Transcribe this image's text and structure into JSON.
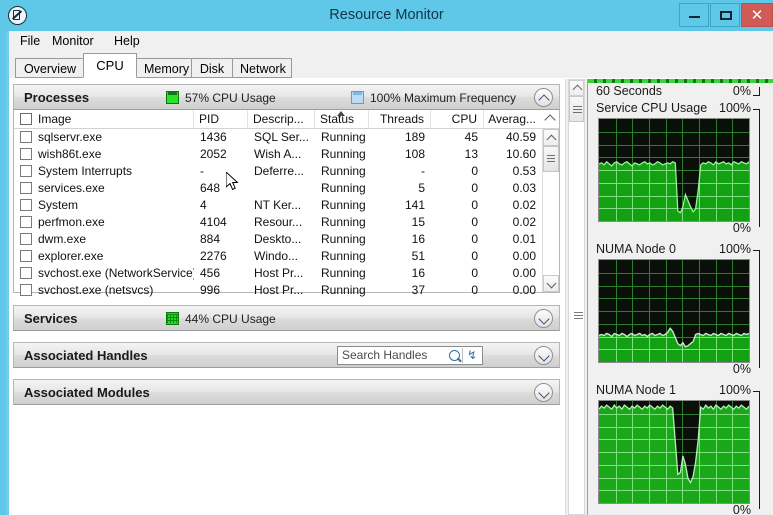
{
  "window": {
    "title": "Resource Monitor",
    "icon": "resource-monitor-icon",
    "minimize_label": "–",
    "maximize_label": "□",
    "close_label": "✕"
  },
  "menu": {
    "items": [
      {
        "label": "File"
      },
      {
        "label": "Monitor"
      },
      {
        "label": "Help"
      }
    ]
  },
  "tabs": {
    "active": "CPU",
    "items": [
      {
        "label": "Overview"
      },
      {
        "label": "CPU"
      },
      {
        "label": "Memory"
      },
      {
        "label": "Disk"
      },
      {
        "label": "Network"
      }
    ]
  },
  "sections": {
    "processes": {
      "title": "Processes",
      "cpu_usage": "57% CPU Usage",
      "max_frequency": "100% Maximum Frequency",
      "expanded": true,
      "columns": [
        {
          "key": "image",
          "label": "Image"
        },
        {
          "key": "pid",
          "label": "PID"
        },
        {
          "key": "desc",
          "label": "Descrip..."
        },
        {
          "key": "status",
          "label": "Status"
        },
        {
          "key": "threads",
          "label": "Threads"
        },
        {
          "key": "cpu",
          "label": "CPU"
        },
        {
          "key": "average",
          "label": "Averag..."
        }
      ],
      "sort_column": "Status",
      "rows": [
        {
          "image": "sqlservr.exe",
          "pid": "1436",
          "desc": "SQL Ser...",
          "status": "Running",
          "threads": "189",
          "cpu": "45",
          "average": "40.59"
        },
        {
          "image": "wish86t.exe",
          "pid": "2052",
          "desc": "Wish A...",
          "status": "Running",
          "threads": "108",
          "cpu": "13",
          "average": "10.60"
        },
        {
          "image": "System Interrupts",
          "pid": "-",
          "desc": "Deferre...",
          "status": "Running",
          "threads": "-",
          "cpu": "0",
          "average": "0.53"
        },
        {
          "image": "services.exe",
          "pid": "648",
          "desc": "",
          "status": "Running",
          "threads": "5",
          "cpu": "0",
          "average": "0.03"
        },
        {
          "image": "System",
          "pid": "4",
          "desc": "NT Ker...",
          "status": "Running",
          "threads": "141",
          "cpu": "0",
          "average": "0.02"
        },
        {
          "image": "perfmon.exe",
          "pid": "4104",
          "desc": "Resour...",
          "status": "Running",
          "threads": "15",
          "cpu": "0",
          "average": "0.02"
        },
        {
          "image": "dwm.exe",
          "pid": "884",
          "desc": "Deskto...",
          "status": "Running",
          "threads": "16",
          "cpu": "0",
          "average": "0.01"
        },
        {
          "image": "explorer.exe",
          "pid": "2276",
          "desc": "Windo...",
          "status": "Running",
          "threads": "51",
          "cpu": "0",
          "average": "0.00"
        },
        {
          "image": "svchost.exe (NetworkService)",
          "pid": "456",
          "desc": "Host Pr...",
          "status": "Running",
          "threads": "16",
          "cpu": "0",
          "average": "0.00"
        },
        {
          "image": "svchost.exe (netsvcs)",
          "pid": "996",
          "desc": "Host Pr...",
          "status": "Running",
          "threads": "37",
          "cpu": "0",
          "average": "0.00"
        }
      ]
    },
    "services": {
      "title": "Services",
      "cpu_usage": "44% CPU Usage",
      "expanded": false
    },
    "associated_handles": {
      "title": "Associated Handles",
      "search_placeholder": "Search Handles",
      "search_value": "",
      "expanded": false
    },
    "associated_modules": {
      "title": "Associated Modules",
      "expanded": false
    }
  },
  "graphs": [
    {
      "name": "cpu-total-graph",
      "label": "60 Seconds",
      "value": "0%",
      "top_label": "",
      "is_strip": true
    },
    {
      "name": "service-cpu-usage-graph",
      "label": "Service CPU Usage",
      "top_value": "100%",
      "bottom_value": "0%"
    },
    {
      "name": "numa-node-0-graph",
      "label": "NUMA Node 0",
      "top_value": "100%",
      "bottom_value": "0%"
    },
    {
      "name": "numa-node-1-graph",
      "label": "NUMA Node 1",
      "top_value": "100%",
      "bottom_value": "0%"
    }
  ],
  "chart_data": [
    {
      "type": "area",
      "title": "Service CPU Usage",
      "ylabel": "%",
      "xlabel": "60 Seconds",
      "ylim": [
        0,
        100
      ],
      "grid": true,
      "line_color": "#9cf09c",
      "fill_color": "#13a013",
      "bg_color": "#0a0f0a",
      "values": [
        56,
        57,
        55,
        58,
        56,
        54,
        57,
        58,
        56,
        55,
        57,
        58,
        56,
        54,
        57,
        56,
        55,
        57,
        58,
        56,
        57,
        55,
        56,
        58,
        57,
        55,
        56,
        57,
        56,
        58,
        57,
        10,
        8,
        14,
        26,
        20,
        14,
        9,
        12,
        30,
        55,
        57,
        56,
        58,
        57,
        55,
        58,
        56,
        57,
        58,
        56,
        57,
        55,
        58,
        57,
        56,
        58,
        57,
        56,
        58
      ]
    },
    {
      "type": "area",
      "title": "NUMA Node 0",
      "ylabel": "%",
      "ylim": [
        0,
        100
      ],
      "grid": true,
      "line_color": "#cfeccf",
      "fill_color": "#13a013",
      "bg_color": "#0a0f0a",
      "values": [
        26,
        27,
        26,
        28,
        27,
        25,
        28,
        27,
        26,
        28,
        27,
        25,
        27,
        28,
        26,
        27,
        28,
        26,
        27,
        25,
        27,
        28,
        26,
        27,
        28,
        26,
        27,
        29,
        33,
        30,
        24,
        18,
        16,
        19,
        15,
        16,
        18,
        20,
        27,
        28,
        27,
        26,
        28,
        27,
        26,
        28,
        27,
        26,
        28,
        27,
        26,
        28,
        27,
        26,
        28,
        27,
        26,
        28,
        27,
        28
      ]
    },
    {
      "type": "area",
      "title": "NUMA Node 1",
      "ylabel": "%",
      "ylim": [
        0,
        100
      ],
      "grid": true,
      "line_color": "#b6f0b6",
      "fill_color": "#1aa81a",
      "bg_color": "#0a0f0a",
      "values": [
        92,
        95,
        93,
        96,
        94,
        92,
        96,
        93,
        95,
        92,
        96,
        94,
        92,
        95,
        93,
        96,
        94,
        92,
        95,
        93,
        96,
        94,
        92,
        95,
        93,
        96,
        94,
        92,
        95,
        93,
        60,
        28,
        30,
        46,
        38,
        24,
        20,
        26,
        40,
        62,
        94,
        92,
        96,
        93,
        95,
        92,
        96,
        94,
        92,
        95,
        93,
        96,
        94,
        92,
        95,
        93,
        96,
        94,
        92,
        95
      ]
    }
  ],
  "icons": {
    "cpu_usage_icon": "green-chart-icon",
    "max_frequency_icon": "blue-chart-icon",
    "services_cpu_icon": "green-grid-icon",
    "search_icon": "magnifier-icon",
    "refresh_icon": "↯",
    "collapse_icon": "chevron-up-icon",
    "expand_icon": "chevron-down-icon"
  },
  "colors": {
    "titlebar": "#5fc8e8",
    "close_button": "#d05a55",
    "graph_green": "#13a013",
    "graph_line": "#9cf09c",
    "graph_bg": "#0a0f0a",
    "accent_blue": "#2f6ea8"
  }
}
